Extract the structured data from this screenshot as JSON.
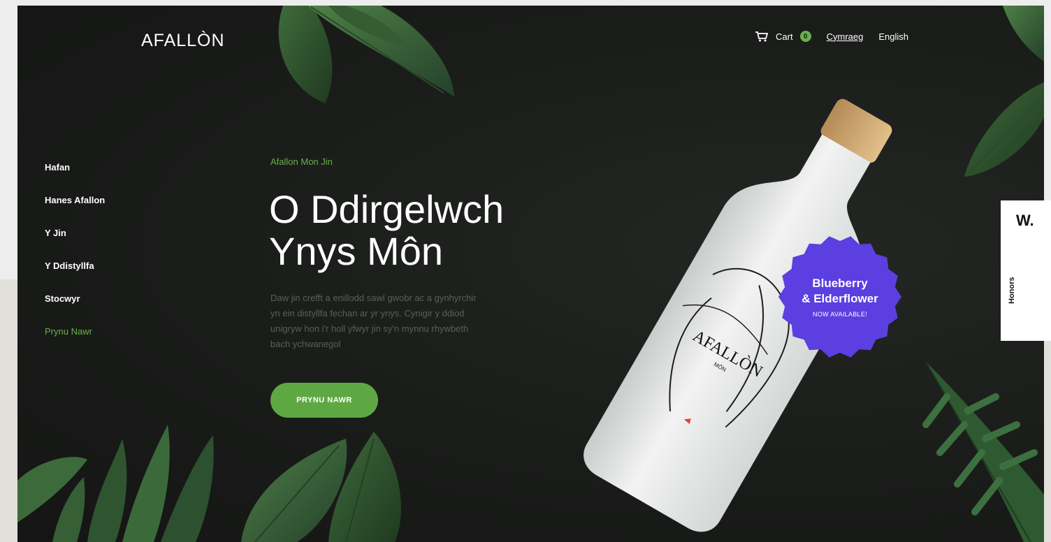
{
  "brand": {
    "logo": "AFALLÒN"
  },
  "header": {
    "cart_label": "Cart",
    "cart_count": "0",
    "lang_welsh": "Cymraeg",
    "lang_english": "English"
  },
  "sidebar": {
    "items": [
      {
        "label": "Hafan"
      },
      {
        "label": "Hanes Afallon"
      },
      {
        "label": "Y Jin"
      },
      {
        "label": "Y Ddistyllfa"
      },
      {
        "label": "Stocwyr"
      },
      {
        "label": "Prynu Nawr"
      }
    ]
  },
  "hero": {
    "eyebrow": "Afallon Mon Jin",
    "title_line1": "O Ddirgelwch",
    "title_line2": "Ynys Môn",
    "description": "Daw jin crefft a enillodd sawl gwobr ac a gynhyrchir yn ein distyllfa fechan ar yr ynys. Cynigir y ddiod unigryw hon i'r holl yfwyr jin sy'n mynnu rhywbeth bach ychwanegol",
    "cta_label": "PRYNU NAWR"
  },
  "bottle": {
    "label_brand": "AFALLÒN",
    "label_sub": "MÔN"
  },
  "badge": {
    "line1": "Blueberry",
    "line2": "& Elderflower",
    "sub": "NOW AVAILABLE!"
  },
  "honors_widget": {
    "logo": "W.",
    "label": "Honors"
  },
  "colors": {
    "accent_green": "#6ab04c",
    "badge_purple": "#5b3fe0",
    "background_dark": "#1b1d1b"
  },
  "icons": {
    "cart": "shopping-cart-icon"
  }
}
